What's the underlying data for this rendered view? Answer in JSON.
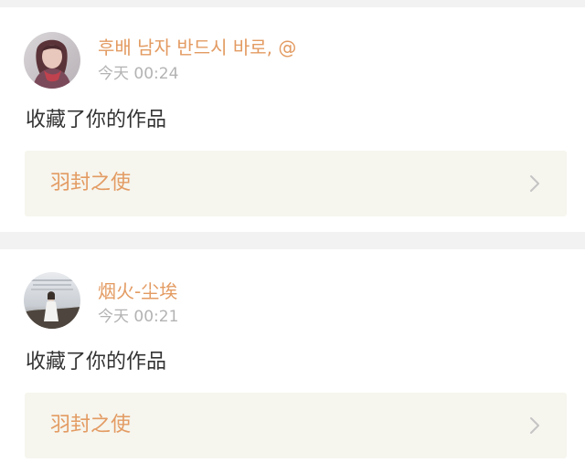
{
  "feed": {
    "items": [
      {
        "username": "후배 남자 반드시 바로, @",
        "time": "今天 00:24",
        "action": "收藏了你的作品",
        "work_title": "羽封之使",
        "avatar_icon": "user-avatar-photo"
      },
      {
        "username": "烟火-尘埃",
        "time": "今天 00:21",
        "action": "收藏了你的作品",
        "work_title": "羽封之使",
        "avatar_icon": "user-avatar-photo"
      }
    ]
  },
  "colors": {
    "accent": "#e39b62",
    "meta": "#b3b3b3",
    "text": "#333333",
    "link_bg": "#f6f5ee",
    "divider_bg": "#f2f2f2"
  }
}
